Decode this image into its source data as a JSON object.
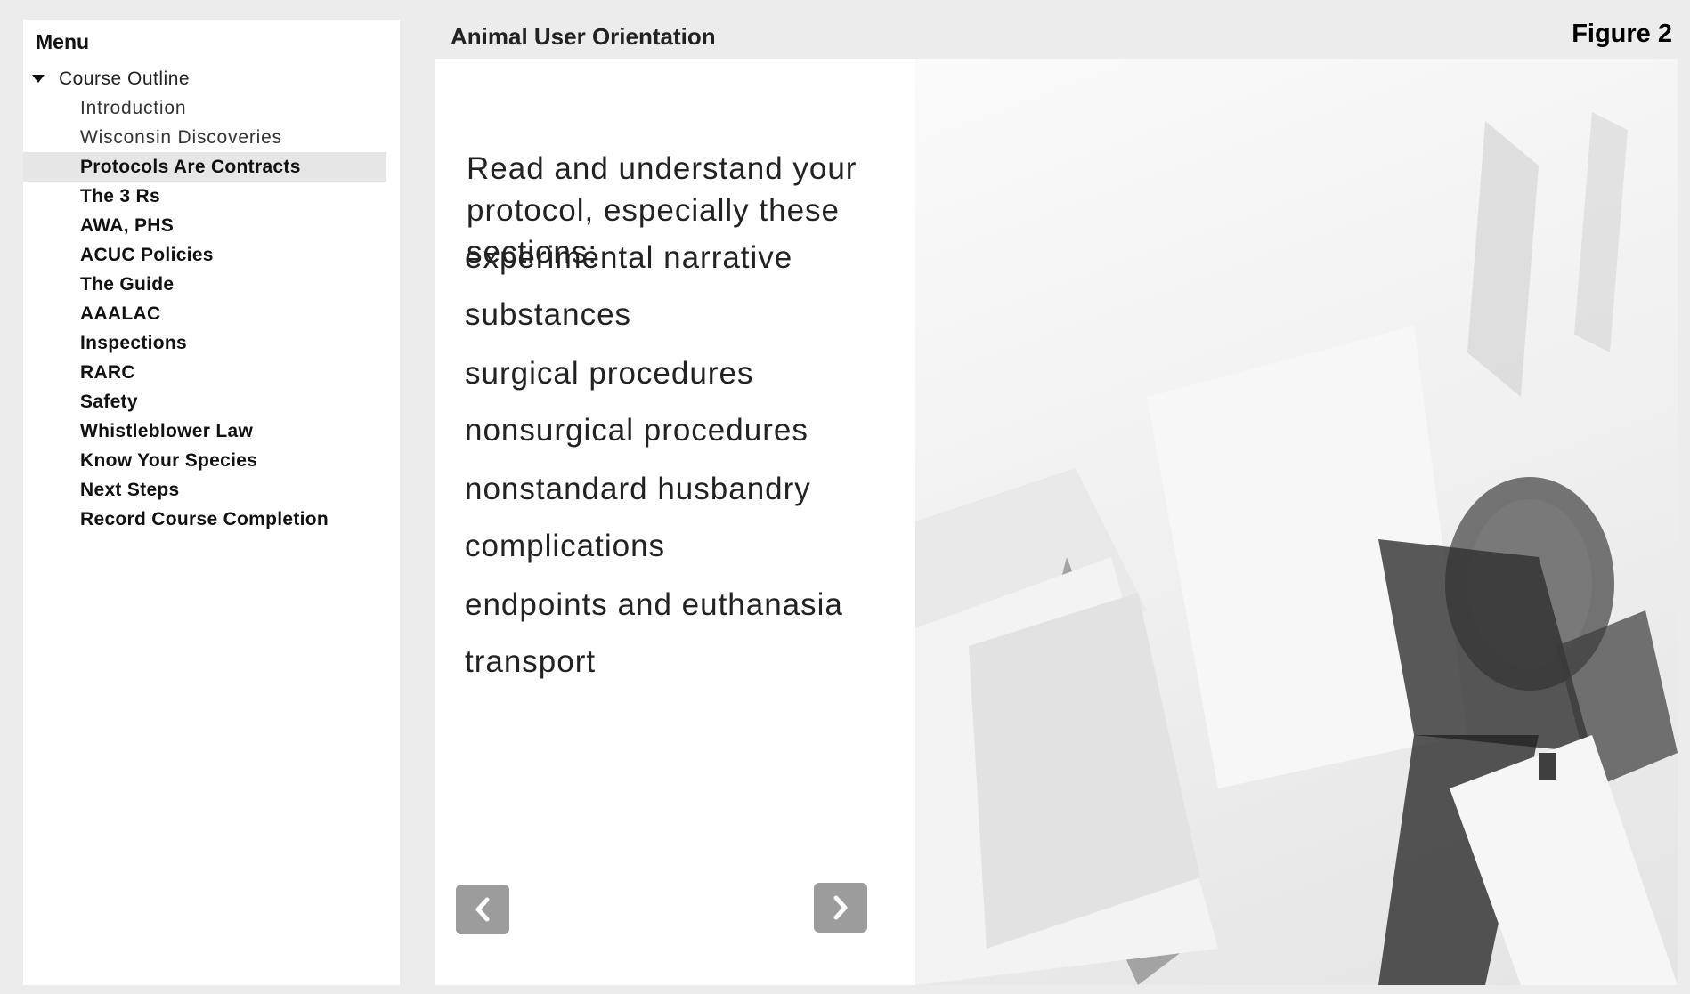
{
  "figure_label": "Figure 2",
  "sidebar": {
    "menu_title": "Menu",
    "outline_header": "Course Outline",
    "items": [
      {
        "label": "Introduction"
      },
      {
        "label": "Wisconsin Discoveries"
      },
      {
        "label": "Protocols Are Contracts"
      },
      {
        "label": "The 3 Rs"
      },
      {
        "label": "AWA, PHS"
      },
      {
        "label": "ACUC Policies"
      },
      {
        "label": "The Guide"
      },
      {
        "label": "AAALAC"
      },
      {
        "label": "Inspections"
      },
      {
        "label": "RARC"
      },
      {
        "label": "Safety"
      },
      {
        "label": "Whistleblower Law"
      },
      {
        "label": "Know Your Species"
      },
      {
        "label": "Next Steps"
      },
      {
        "label": "Record Course Completion"
      }
    ]
  },
  "main": {
    "course_title": "Animal User Orientation",
    "intro": "Read and understand your protocol, especially these sections:",
    "sections": [
      "experimental narrative",
      "substances",
      "surgical procedures",
      "nonsurgical procedures",
      "nonstandard husbandry",
      "complications",
      "endpoints and euthanasia",
      "transport"
    ],
    "nav": {
      "prev_icon": "chevron-left-icon",
      "next_icon": "chevron-right-icon"
    }
  }
}
